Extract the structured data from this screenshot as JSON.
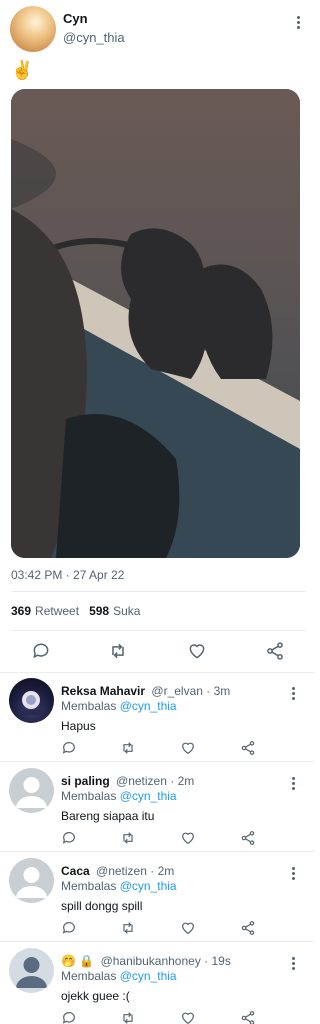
{
  "tweet": {
    "author_name": "Cyn",
    "author_handle": "@cyn_thia",
    "text": "✌️",
    "timestamp": "03:42 PM · 27 Apr 22",
    "retweet_count": "369",
    "retweet_label": "Retweet",
    "like_count": "598",
    "like_label": "Suka"
  },
  "replies": [
    {
      "name": "Reksa Mahavir",
      "handle": "@r_elvan",
      "time": "· 3m",
      "replying_prefix": "Membalas",
      "replying_to": "@cyn_thia",
      "text": "Hapus"
    },
    {
      "name": "si paling",
      "handle": "@netizen",
      "time": "· 2m",
      "replying_prefix": "Membalas",
      "replying_to": "@cyn_thia",
      "text": "Bareng siapaa itu"
    },
    {
      "name": "Caca",
      "handle": "@netizen",
      "time": "· 2m",
      "replying_prefix": "Membalas",
      "replying_to": "@cyn_thia",
      "text": "spill dongg spill"
    },
    {
      "name_prefix": "🤭 🔒",
      "name": "",
      "handle": "@hanibukanhoney",
      "time": "· 19s",
      "replying_prefix": "Membalas",
      "replying_to": "@cyn_thia",
      "text": "ojekk guee :("
    }
  ],
  "colors": {
    "link": "#1d9bf0",
    "secondary_text": "#536471",
    "primary_text": "#0f1419"
  }
}
